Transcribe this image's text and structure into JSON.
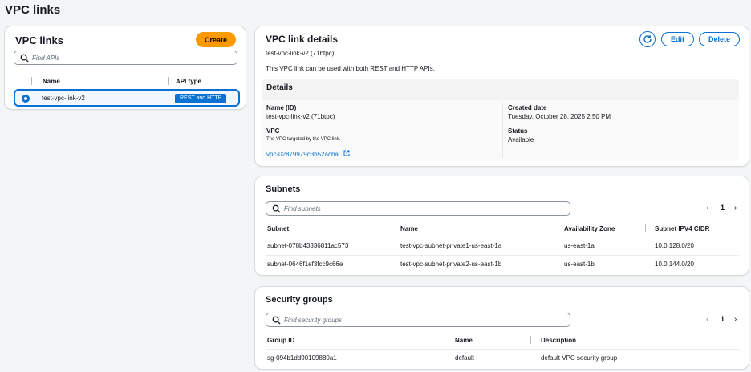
{
  "page": {
    "title": "VPC links"
  },
  "left": {
    "title": "VPC links",
    "create_label": "Create",
    "search_placeholder": "Find APIs",
    "columns": [
      "Name",
      "API type"
    ],
    "rows": [
      {
        "name": "test-vpc-link-v2",
        "api_type": "REST and HTTP"
      }
    ]
  },
  "detail": {
    "title": "VPC link details",
    "subtitle": "test-vpc-link-v2 (71btpc)",
    "description": "This VPC link can be used with both REST and HTTP APIs.",
    "edit_label": "Edit",
    "delete_label": "Delete",
    "details_heading": "Details",
    "name_label": "Name (ID)",
    "name_value": "test-vpc-link-v2 (71btpc)",
    "vpc_label": "VPC",
    "vpc_help": "The VPC targeted by the VPC link.",
    "vpc_value": "vpc-02879979c3b52acba",
    "created_label": "Created date",
    "created_value": "Tuesday, October 28, 2025 2:50 PM",
    "status_label": "Status",
    "status_value": "Available"
  },
  "subnets": {
    "title": "Subnets",
    "search_placeholder": "Find subnets",
    "page": "1",
    "columns": [
      "Subnet",
      "Name",
      "Availability Zone",
      "Subnet IPV4 CIDR"
    ],
    "rows": [
      [
        "subnet-078b43336811ac573",
        "test-vpc-subnet-private1-us-east-1a",
        "us-east-1a",
        "10.0.128.0/20"
      ],
      [
        "subnet-0646f1ef3fcc9c66e",
        "test-vpc-subnet-private2-us-east-1b",
        "us-east-1b",
        "10.0.144.0/20"
      ]
    ]
  },
  "security_groups": {
    "title": "Security groups",
    "search_placeholder": "Find security groups",
    "page": "1",
    "columns": [
      "Group ID",
      "Name",
      "Description"
    ],
    "rows": [
      [
        "sg-094b1dd90109880a1",
        "default",
        "default VPC security group"
      ]
    ]
  },
  "colors": {
    "accent": "#0972d3",
    "create": "#ff9900"
  },
  "icons": [
    "search-icon",
    "refresh-icon",
    "external-link-icon",
    "chevron-left-icon",
    "chevron-right-icon"
  ]
}
